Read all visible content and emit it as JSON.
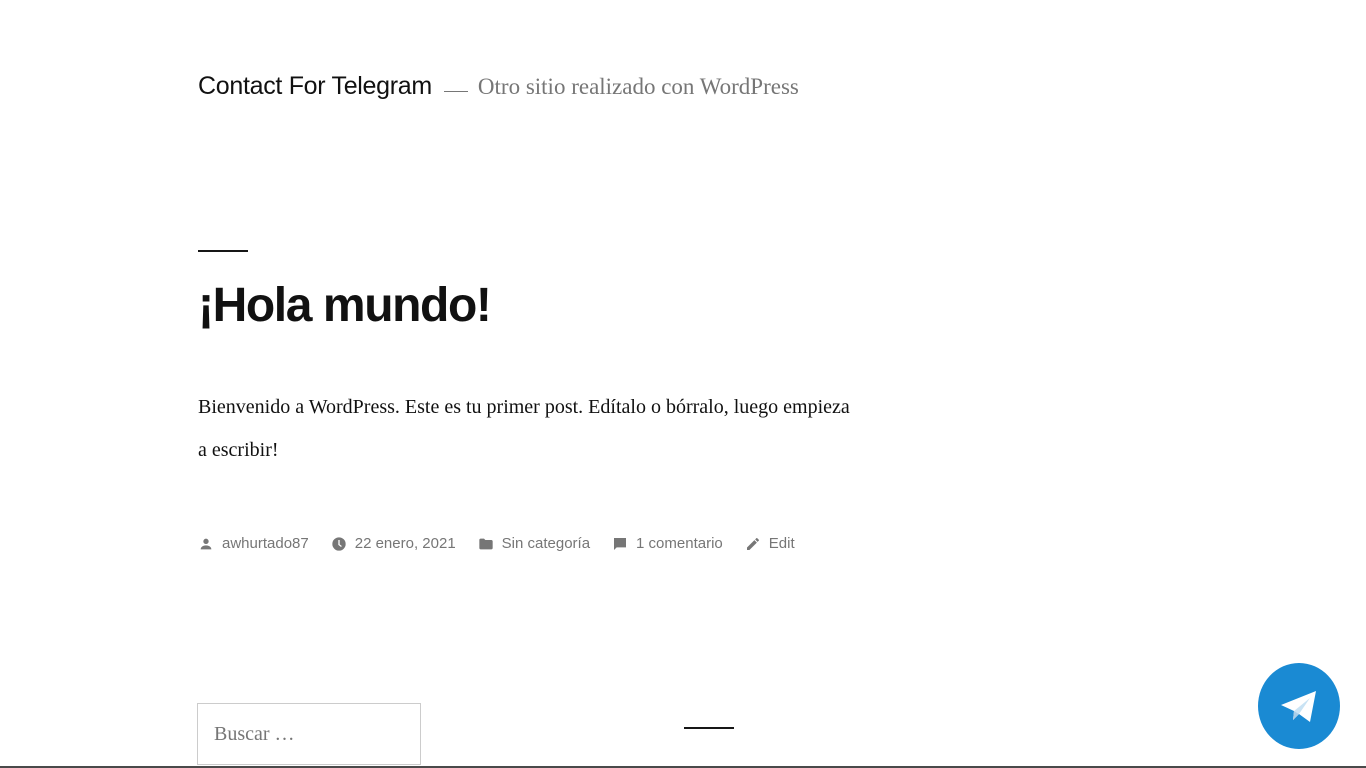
{
  "header": {
    "site_title": "Contact For Telegram",
    "site_description": "Otro sitio realizado con WordPress"
  },
  "post": {
    "title": "¡Hola mundo!",
    "content": "Bienvenido a WordPress. Este es tu primer post. Edítalo o bórralo, luego empieza a escribir!",
    "meta": {
      "author": "awhurtado87",
      "date": "22 enero, 2021",
      "category": "Sin categoría",
      "comments": "1 comentario",
      "edit": "Edit"
    }
  },
  "search": {
    "placeholder": "Buscar …"
  },
  "icons": {
    "author": "person-icon",
    "date": "clock-icon",
    "category": "folder-icon",
    "comments": "comment-icon",
    "edit": "pencil-icon",
    "telegram": "telegram-icon"
  },
  "colors": {
    "telegram_blue": "#1a8ad3",
    "meta_gray": "#767676",
    "text": "#111111"
  }
}
